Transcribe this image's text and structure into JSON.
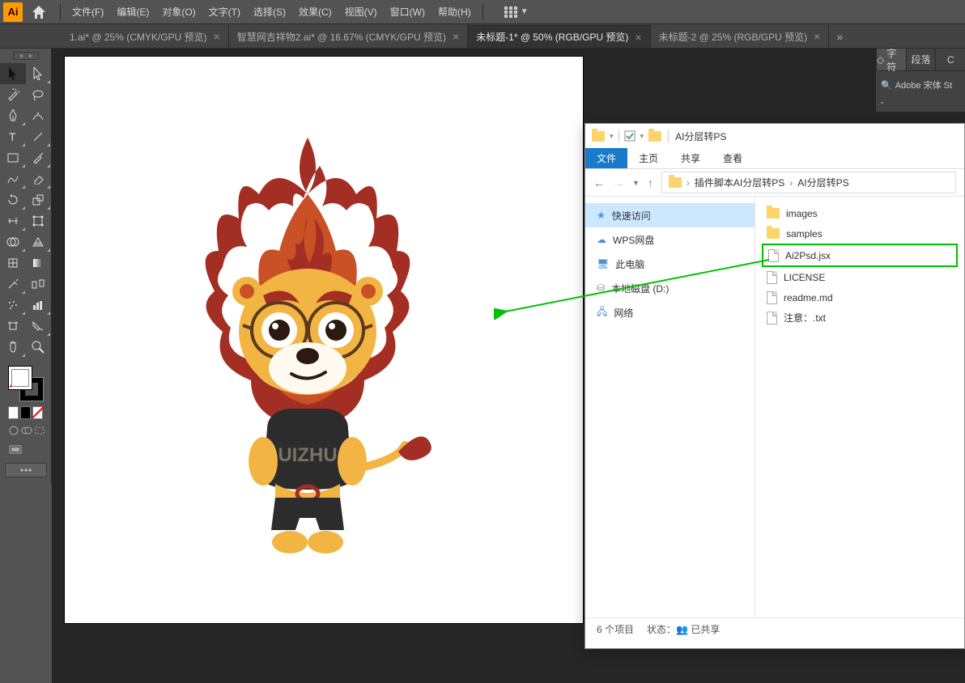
{
  "app": {
    "logo": "Ai"
  },
  "menu": [
    "文件(F)",
    "编辑(E)",
    "对象(O)",
    "文字(T)",
    "选择(S)",
    "效果(C)",
    "视图(V)",
    "窗口(W)",
    "帮助(H)"
  ],
  "tabs": [
    {
      "label": "1.ai* @ 25% (CMYK/GPU 预览)",
      "active": false
    },
    {
      "label": "智慧网吉祥物2.ai* @ 16.67% (CMYK/GPU 预览)",
      "active": false
    },
    {
      "label": "未标题-1* @ 50% (RGB/GPU 预览)",
      "active": true
    },
    {
      "label": "未标题-2 @ 25% (RGB/GPU 预览)",
      "active": false
    }
  ],
  "panels": {
    "tabs": [
      {
        "label": "字符",
        "icon": "◇"
      },
      {
        "label": "段落"
      },
      {
        "label": "C"
      }
    ],
    "font_search_placeholder": "Adobe 宋体 St",
    "font_style": "-"
  },
  "mascot": {
    "shirt_text": "UIZHU"
  },
  "explorer": {
    "title": "AI分层转PS",
    "ribbon": [
      "文件",
      "主页",
      "共享",
      "查看"
    ],
    "path": [
      "插件脚本AI分层转PS",
      "AI分层转PS"
    ],
    "sidebar": [
      {
        "label": "快速访问",
        "icon": "star",
        "sel": true
      },
      {
        "label": "WPS网盘",
        "icon": "cloud"
      },
      {
        "label": "此电脑",
        "icon": "pc"
      },
      {
        "label": "本地磁盘 (D:)",
        "icon": "disk"
      },
      {
        "label": "网络",
        "icon": "net"
      }
    ],
    "files": [
      {
        "name": "images",
        "type": "folder"
      },
      {
        "name": "samples",
        "type": "folder"
      },
      {
        "name": "Ai2Psd.jsx",
        "type": "jsx",
        "hl": true
      },
      {
        "name": "LICENSE",
        "type": "file"
      },
      {
        "name": "readme.md",
        "type": "file"
      },
      {
        "name": "注意：.txt",
        "type": "file"
      }
    ],
    "status": {
      "count": "6 个项目",
      "state_label": "状态：",
      "state": "已共享"
    }
  }
}
